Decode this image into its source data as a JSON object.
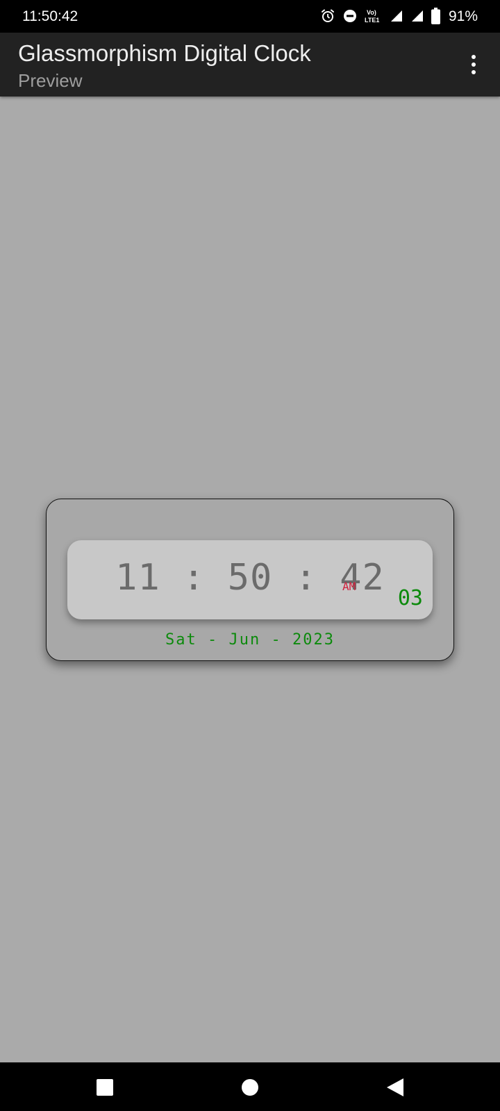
{
  "status_bar": {
    "time": "11:50:42",
    "battery_percent": "91%",
    "icons": [
      "alarm-icon",
      "do-not-disturb-icon",
      "volte-icon",
      "signal-icon",
      "signal-icon",
      "battery-icon"
    ],
    "volte_label": "Vo) LTE1"
  },
  "app_bar": {
    "title": "Glassmorphism Digital Clock",
    "subtitle": "Preview",
    "menu_icon": "more-vert-icon"
  },
  "clock": {
    "time": "11 : 50 : 42",
    "ampm": "AM",
    "day_number": "03",
    "date": "Sat - Jun - 2023",
    "colors": {
      "time": "#6b6b6b",
      "ampm": "#d0203c",
      "accent": "#0c8a0c",
      "background": "#aaaaaa"
    }
  },
  "nav_bar": {
    "buttons": [
      "recents-icon",
      "home-icon",
      "back-icon"
    ]
  }
}
